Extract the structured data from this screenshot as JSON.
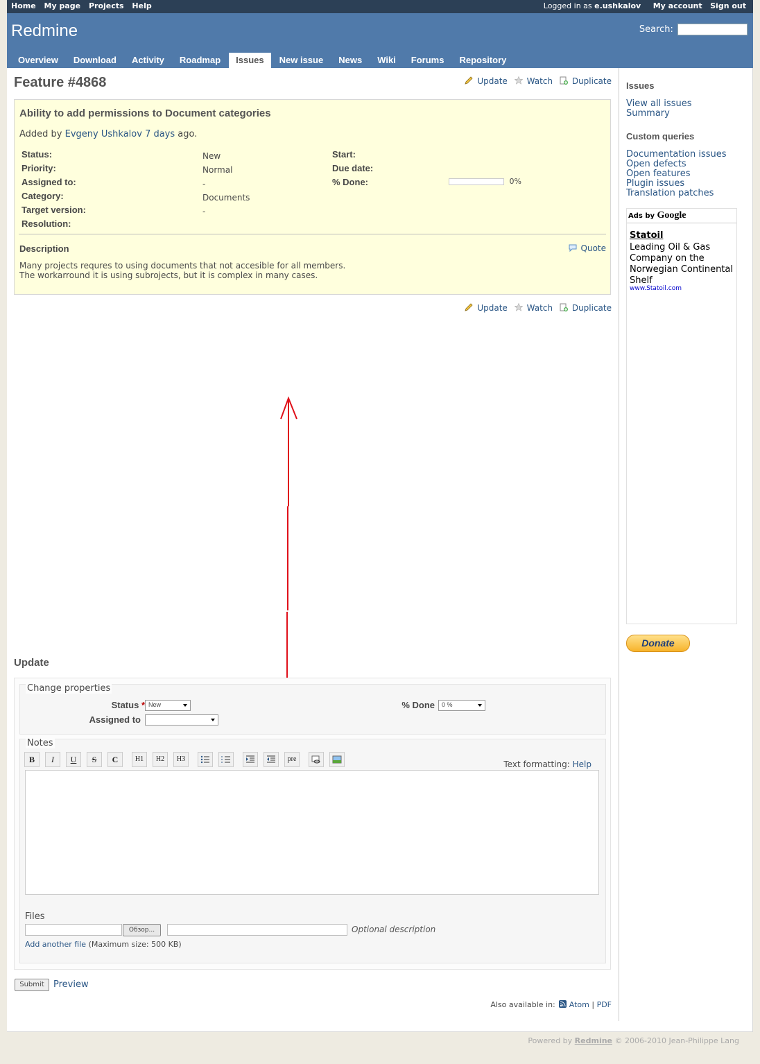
{
  "top_menu": {
    "items": [
      "Home",
      "My page",
      "Projects",
      "Help"
    ],
    "logged_in_prefix": "Logged in as",
    "user": "e.ushkalov",
    "my_account": "My account",
    "sign_out": "Sign out"
  },
  "header": {
    "title": "Redmine",
    "search_label": "Search:",
    "search_value": ""
  },
  "main_menu": {
    "tabs": [
      "Overview",
      "Download",
      "Activity",
      "Roadmap",
      "Issues",
      "New issue",
      "News",
      "Wiki",
      "Forums",
      "Repository"
    ],
    "selected": "Issues"
  },
  "contextual": {
    "update": "Update",
    "watch": "Watch",
    "duplicate": "Duplicate"
  },
  "issue": {
    "heading": "Feature #4868",
    "subject": "Ability to add permissions to Document categories",
    "added_by_prefix": "Added by",
    "author": "Evgeny Ushkalov",
    "age": "7 days",
    "age_suffix": "ago.",
    "attributes": {
      "status_label": "Status:",
      "status": "New",
      "priority_label": "Priority:",
      "priority": "Normal",
      "assigned_label": "Assigned to:",
      "assigned": "-",
      "category_label": "Category:",
      "category": "Documents",
      "target_label": "Target version:",
      "target": "-",
      "resolution_label": "Resolution:",
      "start_label": "Start:",
      "due_label": "Due date:",
      "done_label": "% Done:",
      "done": "0%",
      "done_fraction": 0
    },
    "description_label": "Description",
    "quote": "Quote",
    "description_line1": "Many projects requres to using documents that not accesible for all members.",
    "description_line2": "The workarround it is using subrojects, but it is complex in many cases."
  },
  "update_form": {
    "title": "Update",
    "change_properties": "Change properties",
    "status_label": "Status",
    "status_value": "New",
    "assigned_label": "Assigned to",
    "assigned_value": "",
    "done_label": "% Done",
    "done_value": "0 %",
    "notes_label": "Notes",
    "toolbar": [
      "B",
      "I",
      "U",
      "S",
      "C",
      "H1",
      "H2",
      "H3",
      "ul",
      "ol",
      "indent-right",
      "indent-left",
      "pre",
      "link",
      "image"
    ],
    "text_formatting": "Text formatting:",
    "help": "Help",
    "files_label": "Files",
    "browse": "Обзор...",
    "optional_description": "Optional description",
    "add_another_file": "Add another file",
    "max_size": "(Maximum size: 500 KB)",
    "submit": "Submit",
    "preview": "Preview"
  },
  "other_formats": {
    "label": "Also available in:",
    "atom": "Atom",
    "pdf": "PDF"
  },
  "sidebar": {
    "issues_title": "Issues",
    "issues_links": [
      "View all issues",
      "Summary"
    ],
    "custom_queries_title": "Custom queries",
    "custom_queries": [
      "Documentation issues",
      "Open defects",
      "Open features",
      "Plugin issues",
      "Translation patches"
    ],
    "ads_by": "Ads by",
    "ads_brand": "Google",
    "ad_title": "Statoil",
    "ad_text": "Leading Oil & Gas Company on the Norwegian Continental Shelf",
    "ad_url": "www.Statoil.com",
    "donate": "Donate"
  },
  "footer": {
    "powered_by": "Powered by",
    "redmine": "Redmine",
    "copyright": "© 2006-2010 Jean-Philippe Lang"
  },
  "colors": {
    "top_menu_bg": "#2c4056",
    "header_bg": "#507aaa",
    "issue_bg": "#ffffdd",
    "link": "#2a5685",
    "arrow": "#e0101a"
  }
}
